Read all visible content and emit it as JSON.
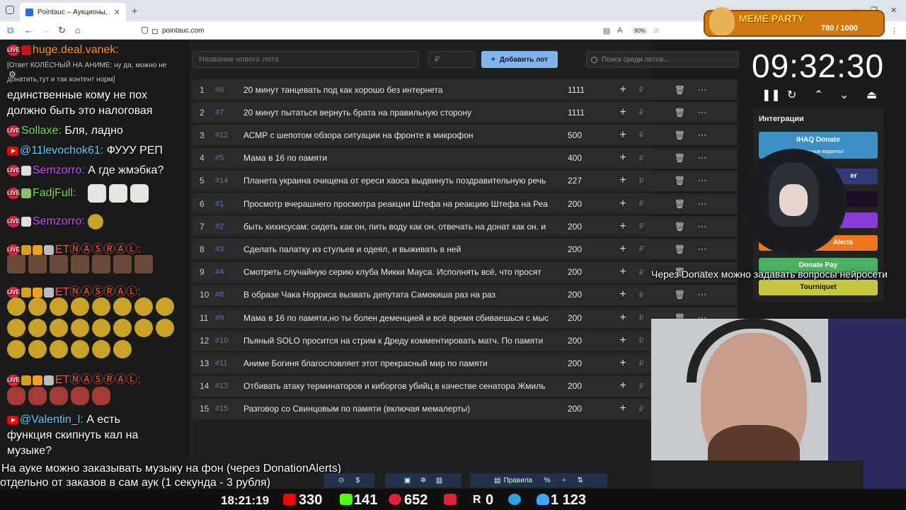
{
  "browser": {
    "tab_title": "Pointauc – Аукционы, лотереи",
    "url": "pointauc.com",
    "zoom": "90%"
  },
  "chat": {
    "m1_nick": "huge.deal.vanek:",
    "m1_reply": "[Ответ КОЛЁСНЫЙ НА АНИМЕ: ну да, можно не",
    "m1_reply2": "донатить,тут и так контент норм]",
    "m2a": "единственные кому не пох",
    "m2b": "должно быть это налоговая",
    "m3_nick": "Sollaxe:",
    "m3_text": "Бля, ладно",
    "m4_nick": "@11levochok61:",
    "m4_text": "ФУУУ РЕП",
    "m5_nick": "Semzorro:",
    "m5_text": "А где жмэбка?",
    "m6_nick": "FadjFull:",
    "m7_nick": "Semzorro:",
    "m8_nick": "ЕТⓃⒶⓈⓇⒶⓁ:",
    "m9_nick": "ЕТⓃⒶⓈⓇⒶⓁ:",
    "m10_nick": "ЕТⓃⒶⓈⓇⒶⓁ:",
    "m11_nick": "@Valentin_l:",
    "m11_text": "А есть",
    "m11b": "функция скипнуть кал на",
    "m11c": "музыке?"
  },
  "auction": {
    "new_lot_placeholder": "Название нового лота",
    "amount_placeholder": "₽",
    "add_label": "Добавить лот",
    "search_placeholder": "Поиск среди лотов...",
    "currency": "₽",
    "lots": [
      {
        "n": "1",
        "id": "#6",
        "name": "20 минут танцевать под как хорошо без интернета",
        "amount": "1111"
      },
      {
        "n": "2",
        "id": "#7",
        "name": "20 минут пытаться вернуть брата на правильную сторону",
        "amount": "1111"
      },
      {
        "n": "3",
        "id": "#12",
        "name": "АСМР с шепотом обзора ситуации на фронте в микрофон",
        "amount": "500"
      },
      {
        "n": "4",
        "id": "#5",
        "name": "Мама в 16 по памяти",
        "amount": "400"
      },
      {
        "n": "5",
        "id": "#14",
        "name": "Планета украина очищена от ереси хаоса выдвинуть поздравительную речь",
        "amount": "227"
      },
      {
        "n": "6",
        "id": "#1",
        "name": "Просмотр вчерашнего просмотра реакции Штефа на реакцию Штефа на Реа",
        "amount": "200"
      },
      {
        "n": "7",
        "id": "#2",
        "name": "быть хихисусам: сидеть как он, пить воду как он, отвечать на донат как он. и",
        "amount": "200"
      },
      {
        "n": "8",
        "id": "#3",
        "name": "Сделать палатку из стульев и одеял, и выживать в ней",
        "amount": "200"
      },
      {
        "n": "9",
        "id": "#4",
        "name": "Смотреть случайную серию клуба Микки Мауса. Исполнять всё, что просят",
        "amount": "200"
      },
      {
        "n": "10",
        "id": "#8",
        "name": "В образе Чака Норриса вызвать депутата Самокиша раз на раз",
        "amount": "200"
      },
      {
        "n": "11",
        "id": "#9",
        "name": "Мама в 16 по памяти,но ты болен деменцией и всё время сбиваешься с мыс",
        "amount": "200"
      },
      {
        "n": "12",
        "id": "#10",
        "name": "Пьяный SOLO просится на стрим к Дреду комментировать матч. По памяти",
        "amount": "200"
      },
      {
        "n": "13",
        "id": "#11",
        "name": "Аниме Богиня благословляет этот прекрасный мир по памяти",
        "amount": "200"
      },
      {
        "n": "14",
        "id": "#13",
        "name": "Отбивать атаку терминаторов и киборгов убийц в качестве сенатора Жмиль",
        "amount": "200"
      },
      {
        "n": "15",
        "id": "#15",
        "name": "Разговор со Свинцовым по памяти (включая мемалерты)",
        "amount": "200"
      }
    ]
  },
  "timer": {
    "value": "09:32:30"
  },
  "integrations": {
    "title": "Интеграции",
    "b1": "IHAQ Donate",
    "b1_sub": "Уникальные виджеты!",
    "b2": "Donate Pay",
    "b3": "Tourniquet",
    "b_alerts": "Alerts",
    "b_er": "er"
  },
  "meme": {
    "title": "MEME PARTY",
    "count": "780 / 1000"
  },
  "overlays": {
    "donatex": "Через Donatex можно задавать вопросы нейросети",
    "music1": "На ауке можно заказывать музыку на фон (через DonationAlerts)",
    "music2": "отдельно от заказов в сам аук (1 секунда - 3 рубля)"
  },
  "toolbar": {
    "rules": "Правила",
    "percent": "%",
    "dollar": "$"
  },
  "stats": {
    "time": "18:21:19",
    "yt": "330",
    "kick": "141",
    "live": "652",
    "r": "0",
    "viewers": "1 123"
  }
}
